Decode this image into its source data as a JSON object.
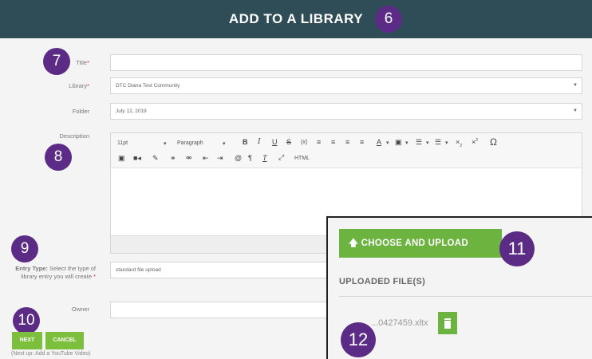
{
  "header": {
    "title": "ADD TO A LIBRARY"
  },
  "badges": {
    "b6": "6",
    "b7": "7",
    "b8": "8",
    "b9": "9",
    "b10": "10",
    "b11": "11",
    "b12": "12"
  },
  "form": {
    "title_label": "Title",
    "library_label": "Library",
    "library_value": "DTC Diana Test Community",
    "folder_label": "Folder",
    "folder_value": "July 12, 2019",
    "description_label": "Description",
    "entry_type_label_bold": "Entry Type:",
    "entry_type_label_rest": "Select the type of library entry you will create",
    "entry_type_value": "standard file upload",
    "owner_label": "Owner",
    "required_mark": "*"
  },
  "editor": {
    "font_size": "11pt",
    "block_format": "Paragraph",
    "html_label": "HTML"
  },
  "buttons": {
    "next": "NEXT",
    "cancel": "CANCEL",
    "next_up": "(Next up: Add a YouTube Video)"
  },
  "upload_panel": {
    "choose_upload": "CHOOSE AND UPLOAD",
    "uploaded_files_title": "UPLOADED FILE(S)",
    "file_name": "...0427459.xltx"
  },
  "colors": {
    "header_bg": "#2e4d57",
    "badge": "#5b2b86",
    "accent_green": "#6db33f"
  },
  "icons": {
    "upload": "cloud-upload-icon",
    "trash": "trash-icon",
    "caret": "caret-down-icon"
  }
}
